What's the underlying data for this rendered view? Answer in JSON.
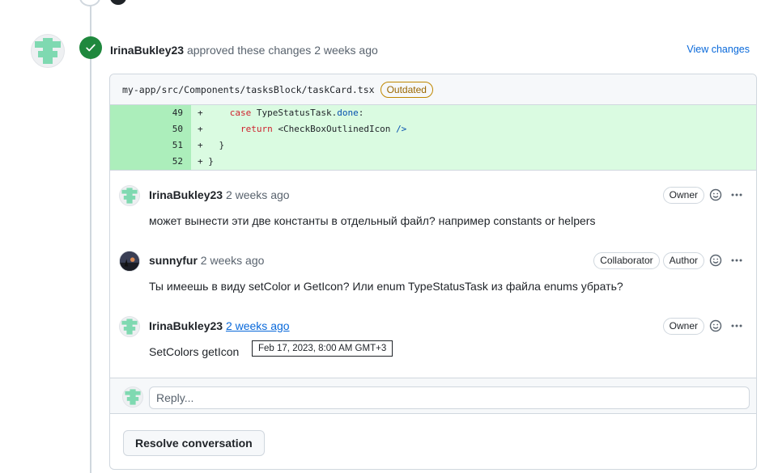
{
  "review": {
    "author": "IrinaBukley23",
    "action": "approved these changes",
    "time": "2 weeks ago",
    "view_changes": "View changes"
  },
  "file": {
    "path": "my-app/src/Components/tasksBlock/taskCard.tsx",
    "status": "Outdated"
  },
  "diff_lines": [
    {
      "num": "49",
      "code_tokens": [
        "+     ",
        "case",
        " TypeStatusTask.",
        "done",
        ":"
      ]
    },
    {
      "num": "50",
      "code_tokens": [
        "+       ",
        "return",
        " <CheckBoxOutlinedIcon ",
        "/>",
        ""
      ]
    },
    {
      "num": "51",
      "code": "+   }"
    },
    {
      "num": "52",
      "code": "+ }"
    }
  ],
  "comments": [
    {
      "author": "IrinaBukley23",
      "time": "2 weeks ago",
      "roles": [
        "Owner"
      ],
      "body": "может вынести эти две константы в отдельный файл? например constants or helpers"
    },
    {
      "author": "sunnyfur",
      "time": "2 weeks ago",
      "roles": [
        "Collaborator",
        "Author"
      ],
      "body": "Ты имеешь в виду setColor и GetIcon? Или enum TypeStatusTask из файла enums убрать?"
    },
    {
      "author": "IrinaBukley23",
      "time": "2 weeks ago",
      "roles": [
        "Owner"
      ],
      "body": "SetColors getIcon"
    }
  ],
  "tooltip": "Feb 17, 2023, 8:00 AM GMT+3",
  "reply": {
    "placeholder": "Reply..."
  },
  "resolve_label": "Resolve conversation",
  "colors": {
    "approve_green": "#1f883d",
    "link_blue": "#0969da",
    "outdated": "#9a6700",
    "diff_add": "#dafbe1",
    "diff_add_num": "#aceebb"
  },
  "icons": [
    "check-icon",
    "smiley-icon",
    "kebab-horizontal-icon",
    "identicon-avatar"
  ]
}
